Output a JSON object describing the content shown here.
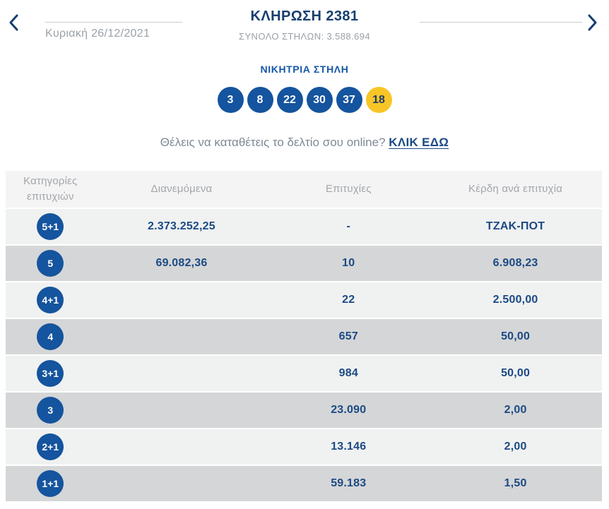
{
  "header": {
    "title": "ΚΛΗΡΩΣΗ 2381",
    "subtitle": "ΣΥΝΟΛΟ ΣΤΗΛΩΝ: 3.588.694",
    "date": "Κυριακή 26/12/2021"
  },
  "winning": {
    "heading": "ΝΙΚΗΤΡΙΑ ΣΤΗΛΗ",
    "numbers": [
      "3",
      "8",
      "22",
      "30",
      "37"
    ],
    "joker": "18"
  },
  "cta": {
    "text": "Θέλεις να καταθέτεις το δελτίο σου online?",
    "link_label": "ΚΛΙΚ ΕΔΩ"
  },
  "table": {
    "headers": [
      "Κατηγορίες επιτυχιών",
      "Διανεμόμενα",
      "Επιτυχίες",
      "Κέρδη ανά επιτυχία"
    ],
    "rows": [
      {
        "category": "5+1",
        "distributed": "2.373.252,25",
        "winners": "-",
        "prize": "ΤΖΑΚ-ΠΟΤ"
      },
      {
        "category": "5",
        "distributed": "69.082,36",
        "winners": "10",
        "prize": "6.908,23"
      },
      {
        "category": "4+1",
        "distributed": "",
        "winners": "22",
        "prize": "2.500,00"
      },
      {
        "category": "4",
        "distributed": "",
        "winners": "657",
        "prize": "50,00"
      },
      {
        "category": "3+1",
        "distributed": "",
        "winners": "984",
        "prize": "50,00"
      },
      {
        "category": "3",
        "distributed": "",
        "winners": "23.090",
        "prize": "2,00"
      },
      {
        "category": "2+1",
        "distributed": "",
        "winners": "13.146",
        "prize": "2,00"
      },
      {
        "category": "1+1",
        "distributed": "",
        "winners": "59.183",
        "prize": "1,50"
      }
    ]
  },
  "colors": {
    "navy": "#173f6f",
    "ball_blue": "#15549e",
    "joker_yellow": "#f8c527",
    "gray_text": "#9aa1a8",
    "row_light": "#f0f1f1",
    "row_dark": "#d5d6d7"
  }
}
